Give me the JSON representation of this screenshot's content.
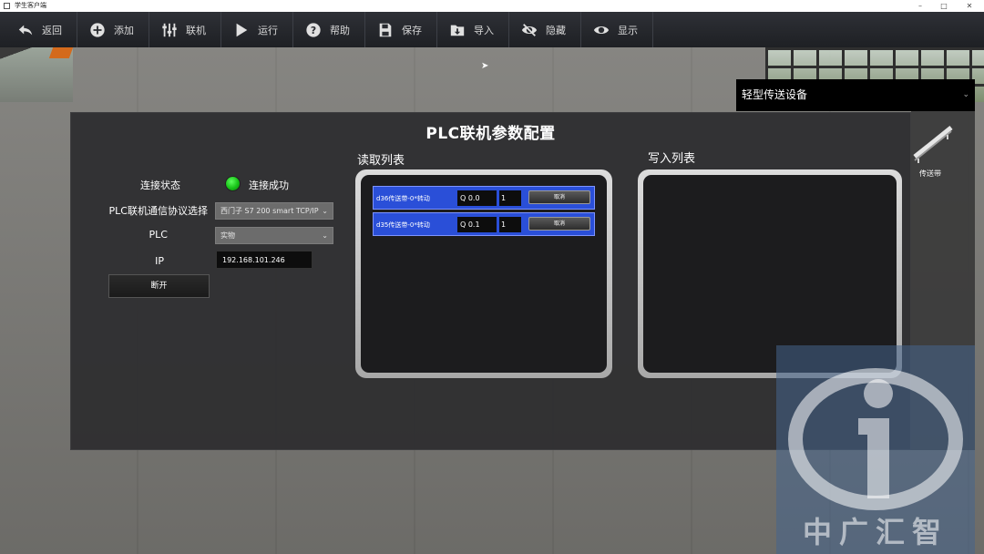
{
  "window": {
    "title": "学生客户端"
  },
  "toolbar": {
    "items": [
      {
        "label": "返回",
        "icon": "back-arrow-icon"
      },
      {
        "label": "添加",
        "icon": "add-circle-icon"
      },
      {
        "label": "联机",
        "icon": "equalizer-icon"
      },
      {
        "label": "运行",
        "icon": "play-icon"
      },
      {
        "label": "帮助",
        "icon": "help-icon"
      },
      {
        "label": "保存",
        "icon": "save-icon"
      },
      {
        "label": "导入",
        "icon": "import-icon"
      },
      {
        "label": "隐藏",
        "icon": "eye-slash-icon"
      },
      {
        "label": "显示",
        "icon": "eye-icon"
      }
    ]
  },
  "device_panel": {
    "selected": "轻型传送设备",
    "item_label": "传送带"
  },
  "dialog": {
    "title": "PLC联机参数配置",
    "connection_status_label": "连接状态",
    "connection_status_text": "连接成功",
    "connection_status_color": "#17c217",
    "protocol_label": "PLC联机通信协议选择",
    "protocol_value": "西门子 S7 200 smart TCP/IP",
    "plc_label": "PLC",
    "plc_value": "实物",
    "ip_label": "IP",
    "ip_value": "192.168.101.246",
    "disconnect_label": "断开",
    "read_list_title": "读取列表",
    "write_list_title": "写入列表",
    "read_rows": [
      {
        "name": "d36传送带-0*转动",
        "address": "Q 0.0",
        "value": "1",
        "cancel": "取消"
      },
      {
        "name": "d35传送带-0*转动",
        "address": "Q 0.1",
        "value": "1",
        "cancel": "取消"
      }
    ],
    "write_rows": []
  },
  "watermark": {
    "text": "中广汇智"
  },
  "colors": {
    "accent": "#2a4fd8",
    "toolbar": "#2a2c31"
  }
}
